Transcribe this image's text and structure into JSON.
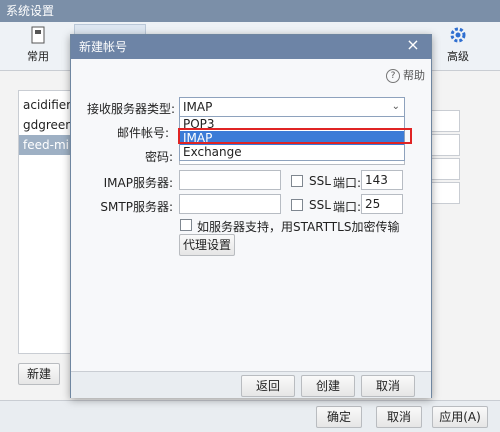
{
  "outer": {
    "title": "系统设置",
    "toolbar": {
      "general": "常用",
      "advanced": "高级"
    },
    "accounts": [
      "acidifier(w",
      "gdgreen(h",
      "feed-mill-t"
    ],
    "new_button": "新建",
    "bottom": {
      "ok": "确定",
      "cancel": "取消",
      "apply": "应用(A)"
    }
  },
  "dialog": {
    "title": "新建帐号",
    "help": "帮助",
    "labels": {
      "server_type": "接收服务器类型:",
      "account": "邮件帐号:",
      "password": "密码:",
      "imap_server": "IMAP服务器:",
      "smtp_server": "SMTP服务器:",
      "ssl": "SSL",
      "port": "端口:",
      "starttls": "如服务器支持，用STARTTLS加密传输",
      "proxy": "代理设置"
    },
    "server_type_value": "IMAP",
    "options": [
      "POP3",
      "IMAP",
      "Exchange"
    ],
    "imap_port": "143",
    "smtp_port": "25",
    "buttons": {
      "back": "返回",
      "create": "创建",
      "cancel": "取消"
    }
  }
}
